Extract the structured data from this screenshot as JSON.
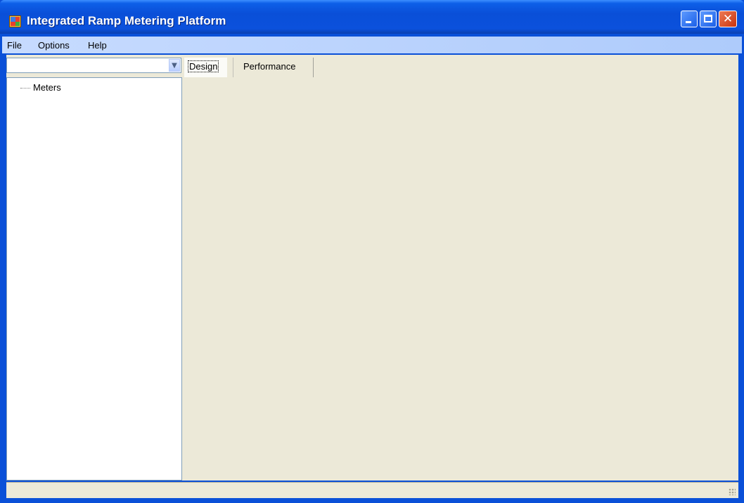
{
  "window": {
    "title": "Integrated Ramp Metering Platform",
    "icon": "app-window-icon",
    "controls": [
      "minimize-icon",
      "maximize-icon",
      "close-icon"
    ],
    "close_glyph": "✕"
  },
  "menu": {
    "items": [
      "File",
      "Options",
      "Help"
    ]
  },
  "combo": {
    "value": "",
    "arrow": "▼"
  },
  "tree": {
    "nodes": [
      {
        "label": "Meters"
      }
    ]
  },
  "tabs": [
    {
      "label": "Design",
      "selected": true
    },
    {
      "label": "Performance",
      "selected": false
    }
  ],
  "status": {
    "text": ""
  },
  "colors": {
    "titlebar": "#0a50d8",
    "menubar": "#c7dbff",
    "client": "#ece9d8"
  }
}
